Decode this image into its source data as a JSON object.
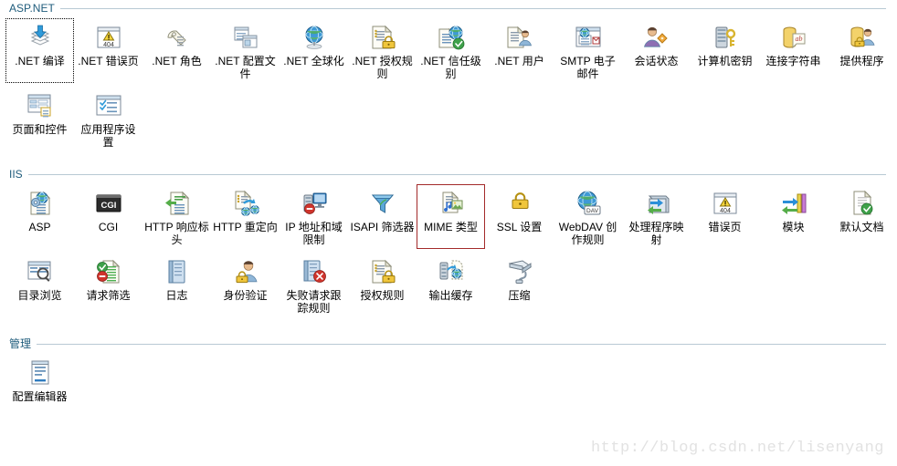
{
  "page": {
    "watermark": "http://blog.csdn.net/lisenyang",
    "header_color": "#1e5b7b",
    "rule_color": "#b8c9d4",
    "selection_color": "#a32a2a",
    "background": "#ffffff"
  },
  "sections": [
    {
      "id": "aspnet",
      "title": "ASP.NET",
      "items": [
        {
          "label": ".NET 编译",
          "icon": "net-compilation-icon",
          "state": "focused"
        },
        {
          "label": ".NET 错误页",
          "icon": "net-error-pages-icon",
          "state": "normal"
        },
        {
          "label": ".NET 角色",
          "icon": "net-roles-icon",
          "state": "normal"
        },
        {
          "label": ".NET 配置文件",
          "icon": "net-profile-icon",
          "state": "normal"
        },
        {
          "label": ".NET 全球化",
          "icon": "net-globalization-icon",
          "state": "normal"
        },
        {
          "label": ".NET 授权规则",
          "icon": "net-authorization-icon",
          "state": "normal"
        },
        {
          "label": ".NET 信任级别",
          "icon": "net-trust-levels-icon",
          "state": "normal"
        },
        {
          "label": ".NET 用户",
          "icon": "net-users-icon",
          "state": "normal"
        },
        {
          "label": "SMTP 电子邮件",
          "icon": "smtp-email-icon",
          "state": "normal"
        },
        {
          "label": "会话状态",
          "icon": "session-state-icon",
          "state": "normal"
        },
        {
          "label": "计算机密钥",
          "icon": "machine-key-icon",
          "state": "normal"
        },
        {
          "label": "连接字符串",
          "icon": "connection-strings-icon",
          "state": "normal"
        },
        {
          "label": "提供程序",
          "icon": "providers-icon",
          "state": "normal"
        },
        {
          "label": "页面和控件",
          "icon": "pages-controls-icon",
          "state": "normal"
        },
        {
          "label": "应用程序设置",
          "icon": "application-settings-icon",
          "state": "normal"
        }
      ]
    },
    {
      "id": "iis",
      "title": "IIS",
      "items": [
        {
          "label": "ASP",
          "icon": "asp-icon",
          "state": "normal"
        },
        {
          "label": "CGI",
          "icon": "cgi-icon",
          "state": "normal"
        },
        {
          "label": "HTTP 响应标头",
          "icon": "http-response-headers-icon",
          "state": "normal"
        },
        {
          "label": "HTTP 重定向",
          "icon": "http-redirect-icon",
          "state": "normal"
        },
        {
          "label": "IP 地址和域限制",
          "icon": "ip-domain-restrictions-icon",
          "state": "normal"
        },
        {
          "label": "ISAPI 筛选器",
          "icon": "isapi-filters-icon",
          "state": "normal"
        },
        {
          "label": "MIME 类型",
          "icon": "mime-types-icon",
          "state": "selected"
        },
        {
          "label": "SSL 设置",
          "icon": "ssl-settings-icon",
          "state": "normal"
        },
        {
          "label": "WebDAV 创作规则",
          "icon": "webdav-authoring-rules-icon",
          "state": "normal"
        },
        {
          "label": "处理程序映射",
          "icon": "handler-mappings-icon",
          "state": "normal"
        },
        {
          "label": "错误页",
          "icon": "error-pages-icon",
          "state": "normal"
        },
        {
          "label": "模块",
          "icon": "modules-icon",
          "state": "normal"
        },
        {
          "label": "默认文档",
          "icon": "default-document-icon",
          "state": "normal"
        },
        {
          "label": "目录浏览",
          "icon": "directory-browsing-icon",
          "state": "normal"
        },
        {
          "label": "请求筛选",
          "icon": "request-filtering-icon",
          "state": "normal"
        },
        {
          "label": "日志",
          "icon": "logging-icon",
          "state": "normal"
        },
        {
          "label": "身份验证",
          "icon": "authentication-icon",
          "state": "normal"
        },
        {
          "label": "失败请求跟踪规则",
          "icon": "failed-request-tracing-icon",
          "state": "normal"
        },
        {
          "label": "授权规则",
          "icon": "authorization-rules-icon",
          "state": "normal"
        },
        {
          "label": "输出缓存",
          "icon": "output-caching-icon",
          "state": "normal"
        },
        {
          "label": "压缩",
          "icon": "compression-icon",
          "state": "normal"
        }
      ]
    },
    {
      "id": "management",
      "title": "管理",
      "items": [
        {
          "label": "配置编辑器",
          "icon": "configuration-editor-icon",
          "state": "normal"
        }
      ]
    }
  ]
}
